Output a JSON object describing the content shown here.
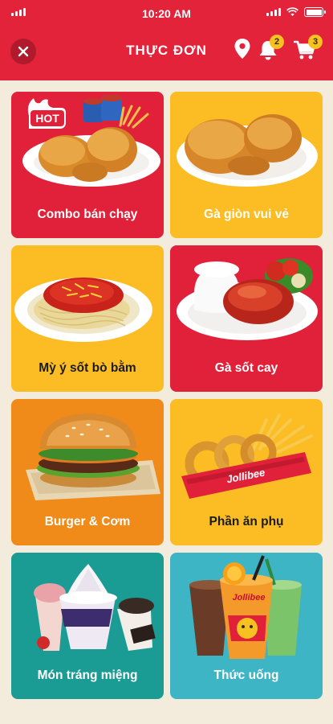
{
  "status_bar": {
    "time": "10:20 AM"
  },
  "header": {
    "title": "THỰC ĐƠN",
    "notification_count": "2",
    "cart_count": "3"
  },
  "menu": [
    {
      "label": "Combo bán chạy",
      "bg": "#e1213a",
      "text_color": "#ffffff",
      "hot_label": "HOT",
      "icon": "chicken-combo"
    },
    {
      "label": "Gà giòn vui vẻ",
      "bg": "#fbbd23",
      "text_color": "#ffffff",
      "icon": "fried-chicken"
    },
    {
      "label": "Mỳ ý sốt bò bằm",
      "bg": "#fbbd23",
      "text_color": "#1b1b1b",
      "icon": "spaghetti"
    },
    {
      "label": "Gà sốt cay",
      "bg": "#e1213a",
      "text_color": "#ffffff",
      "icon": "spicy-chicken-rice"
    },
    {
      "label": "Burger & Cơm",
      "bg": "#f08a19",
      "text_color": "#ffffff",
      "icon": "burger"
    },
    {
      "label": "Phần ăn phụ",
      "bg": "#fbbd23",
      "text_color": "#1b1b1b",
      "brand_text": "Jollibee",
      "icon": "fries-onion-rings"
    },
    {
      "label": "Món tráng miệng",
      "bg": "#1a9c95",
      "text_color": "#ffffff",
      "icon": "dessert"
    },
    {
      "label": "Thức uống",
      "bg": "#3eb5c4",
      "text_color": "#ffffff",
      "brand_text": "Jollibee",
      "icon": "drinks"
    }
  ]
}
